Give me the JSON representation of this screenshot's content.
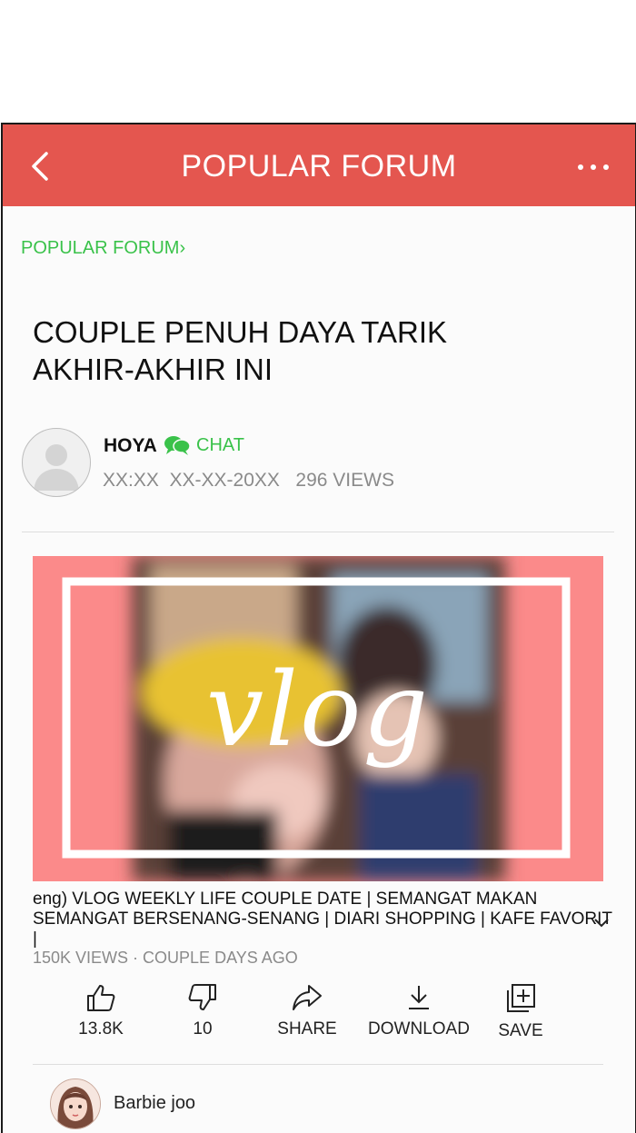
{
  "header": {
    "title": "POPULAR FORUM"
  },
  "breadcrumb": "POPULAR FORUM›",
  "post": {
    "title_line1": "COUPLE PENUH DAYA TARIK",
    "title_line2": "AKHIR-AKHIR INI",
    "author": "HOYA",
    "chat_label": "CHAT",
    "meta": "XX:XX  XX-XX-20XX   296 VIEWS"
  },
  "video": {
    "thumb_text": "vlog",
    "title_line1": "eng) VLOG WEEKLY LIFE COUPLE DATE | SEMANGAT MAKAN",
    "title_line2": "SEMANGAT BERSENANG-SENANG | DIARI SHOPPING | KAFE FAVORIT |",
    "stats": "150K VIEWS · COUPLE DAYS AGO",
    "actions": {
      "like": "13.8K",
      "dislike": "10",
      "share": "SHARE",
      "download": "DOWNLOAD",
      "save": "SAVE"
    }
  },
  "comment": {
    "user": "Barbie joo"
  },
  "colors": {
    "header": "#e4564f",
    "accent_green": "#3ac24a",
    "thumb_pink": "#fb8a8a"
  }
}
